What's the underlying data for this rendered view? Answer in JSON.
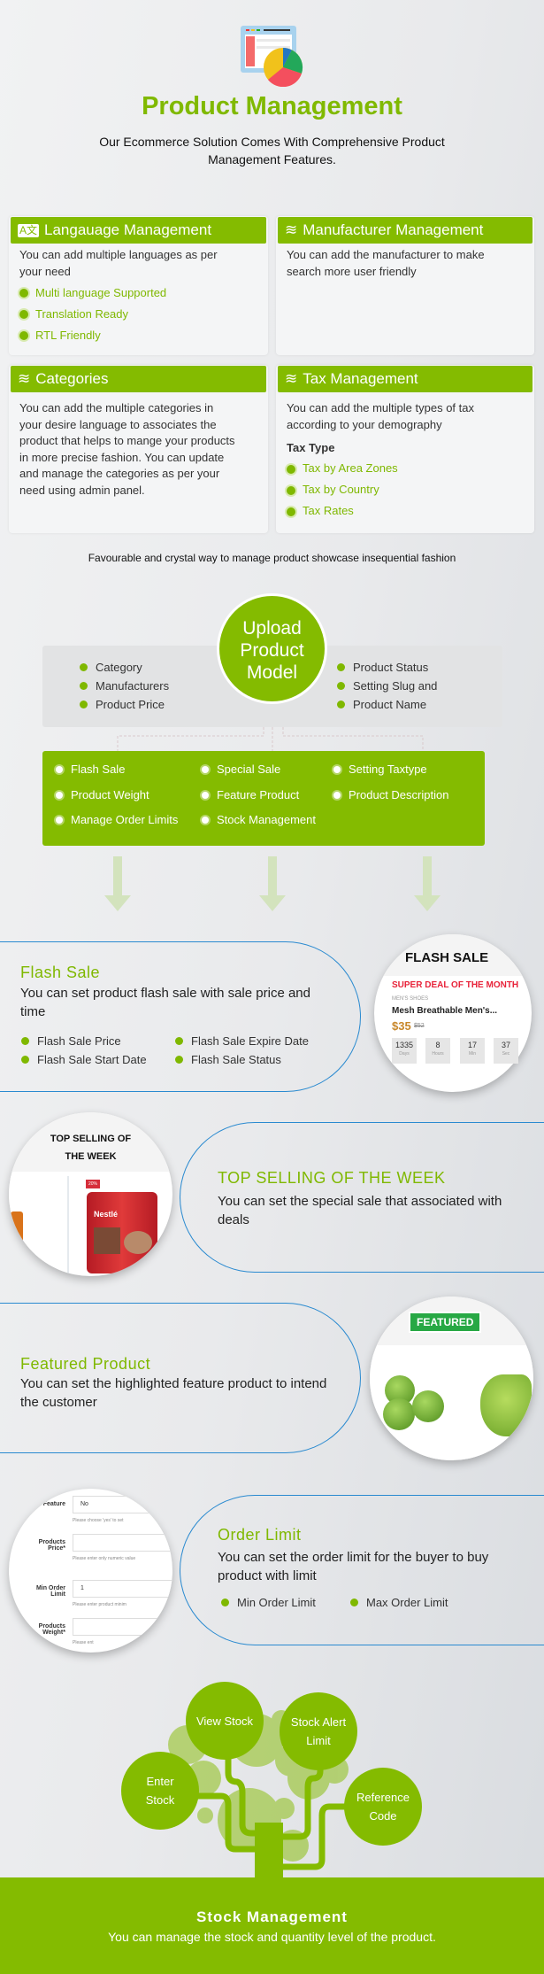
{
  "header": {
    "icon": "dashboard-pie-chart-icon",
    "title": "Product Management",
    "subtitle_lines": [
      "Our Ecommerce Solution Comes With Comprehensive Product",
      "Management Features."
    ]
  },
  "cards": [
    {
      "icon": "translate-icon",
      "title": "Langauage Management",
      "desc": "You can add multiple languages as per your need",
      "items": [
        "Multi language Supported",
        "Translation Ready",
        "RTL Friendly"
      ]
    },
    {
      "icon": "layers-icon",
      "title": "Manufacturer Management",
      "desc": "You can add the manufacturer to make search more user friendly"
    },
    {
      "icon": "layers-icon",
      "title": "Categories",
      "desc": "You can add the multiple categories in your desire language to associates the product that helps to mange your products in more precise fashion. You can update and manage the categories as per your need using admin panel."
    },
    {
      "icon": "layers-icon",
      "title": "Tax Management",
      "desc": "You can add the multiple types of tax according to your demography",
      "subheading": "Tax Type",
      "items": [
        "Tax by Area Zones",
        "Tax by Country",
        "Tax Rates"
      ]
    }
  ],
  "tagline": "Favourable and crystal way to manage product showcase insequential fashion",
  "upload": {
    "title_lines": [
      "Upload",
      "Product",
      "Model"
    ],
    "left_items": [
      "Category",
      "Manufacturers",
      "Product Price"
    ],
    "right_items": [
      "Product Status",
      "Setting Slug and",
      "Product Name"
    ],
    "features": [
      "Flash Sale",
      "Special Sale",
      "Setting Taxtype",
      "Product Weight",
      "Feature Product",
      "Product Description",
      "Manage Order Limits",
      "Stock Management"
    ]
  },
  "flash_sale": {
    "title": "Flash Sale",
    "desc": "You can set product flash sale with sale price and time",
    "items": [
      "Flash Sale Price",
      "Flash Sale Expire Date",
      "Flash Sale Start Date",
      "Flash Sale Status"
    ],
    "preview": {
      "heading": "FLASH SALE",
      "deal": "SUPER DEAL OF THE MONTH",
      "category": "MEN'S SHOES",
      "product": "Mesh Breathable Men's...",
      "price": "$35",
      "old_price": "$52",
      "countdown": [
        {
          "value": "1335",
          "unit": "Days"
        },
        {
          "value": "8",
          "unit": "Hours"
        },
        {
          "value": "17",
          "unit": "Min"
        },
        {
          "value": "37",
          "unit": "Sec"
        }
      ]
    }
  },
  "top_selling": {
    "title": "TOP SELLING OF THE WEEK",
    "desc": "You can set the special sale that associated with deals",
    "preview": {
      "heading_lines": [
        "TOP SELLING OF",
        "THE WEEK"
      ],
      "badge": "20%",
      "brand": "Nestlé"
    }
  },
  "featured": {
    "title": "Featured Product",
    "desc": "You can set the highlighted feature product to intend the customer",
    "preview": {
      "badge": "FEATURED"
    }
  },
  "order_limit": {
    "title": "Order Limit",
    "desc": "You can set the order limit for the buyer to buy product with limit",
    "items": [
      "Min Order Limit",
      "Max Order Limit"
    ],
    "preview": {
      "fields": [
        {
          "label": "Is Feature",
          "value": "No",
          "help": "Please choose 'yes' to set"
        },
        {
          "label": "Products Price*",
          "value": "",
          "help": "Please enter only numeric value"
        },
        {
          "label": "Min Order Limit",
          "value": "1",
          "help": "Please enter product minim"
        },
        {
          "label": "Products Weight*",
          "value": "",
          "help": "Please ent"
        }
      ]
    }
  },
  "stock": {
    "bubbles": [
      "View Stock",
      "Stock Alert Limit",
      "Enter Stock",
      "Reference Code"
    ],
    "title": "Stock Management",
    "desc": "You can manage the stock and quantity level of the product."
  },
  "colors": {
    "accent_green": "#84bb00",
    "pill_border": "#2a8ad0",
    "deal_red": "#e8233a",
    "price_orange": "#c8872a"
  }
}
